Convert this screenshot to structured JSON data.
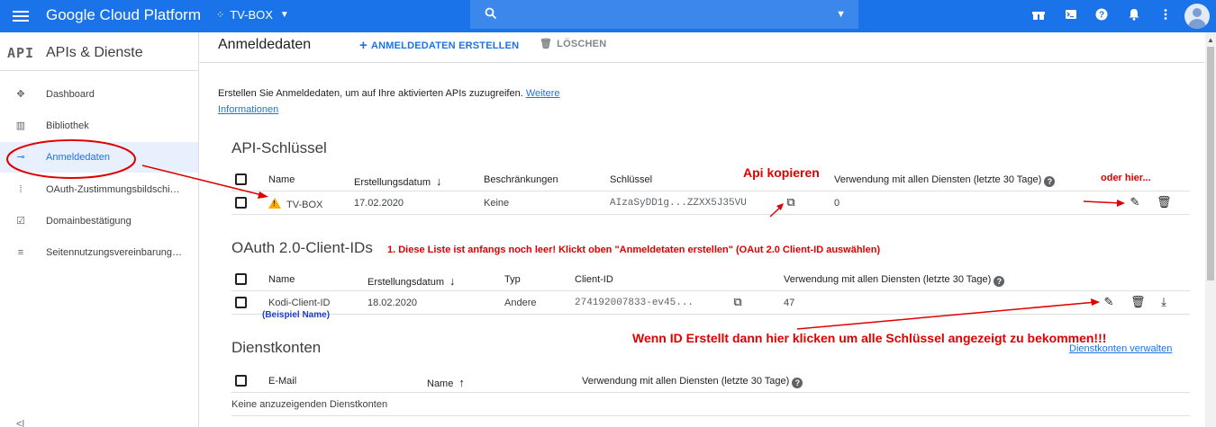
{
  "topbar": {
    "brand": "Google Cloud Platform",
    "project": "TV-BOX",
    "icons": [
      "menu-icon",
      "search-icon",
      "gift-icon",
      "terminal-icon",
      "help-icon",
      "bell-icon",
      "more-icon",
      "avatar"
    ]
  },
  "sidebar": {
    "logo": "API",
    "title": "APIs & Dienste",
    "items": [
      {
        "label": "Dashboard",
        "icon": "dashboard-icon"
      },
      {
        "label": "Bibliothek",
        "icon": "library-icon"
      },
      {
        "label": "Anmeldedaten",
        "icon": "key-icon",
        "active": true
      },
      {
        "label": "OAuth-Zustimmungsbildschi…",
        "icon": "consent-icon"
      },
      {
        "label": "Domainbestätigung",
        "icon": "checkbox-icon"
      },
      {
        "label": "Seitennutzungsvereinbarung…",
        "icon": "settings-list-icon"
      }
    ],
    "collapse": "<|"
  },
  "header": {
    "title": "Anmeldedaten",
    "create_label": "ANMELDEDATEN ERSTELLEN",
    "delete_label": "LÖSCHEN"
  },
  "intro": {
    "text": "Erstellen Sie Anmeldedaten, um auf Ihre aktivierten APIs zuzugreifen. ",
    "link1": "Weitere",
    "link2": "Informationen"
  },
  "api_keys": {
    "title": "API-Schlüssel",
    "columns": [
      "Name",
      "Erstellungsdatum",
      "Beschränkungen",
      "Schlüssel",
      "Verwendung mit allen Diensten (letzte 30 Tage)"
    ],
    "rows": [
      {
        "name": "TV-BOX",
        "date": "17.02.2020",
        "restrictions": "Keine",
        "key": "AIzaSyDD1g...ZZXX5J35VU",
        "usage": "0"
      }
    ]
  },
  "oauth": {
    "title": "OAuth 2.0-Client-IDs",
    "columns": [
      "Name",
      "Erstellungsdatum",
      "Typ",
      "Client-ID",
      "Verwendung mit allen Diensten (letzte 30 Tage)"
    ],
    "rows": [
      {
        "name": "Kodi-Client-ID",
        "date": "18.02.2020",
        "type": "Andere",
        "client_id": "274192007833-ev45...",
        "usage": "47"
      }
    ]
  },
  "service_accounts": {
    "title": "Dienstkonten",
    "manage_link": "Dienstkonten verwalten",
    "columns": [
      "E-Mail",
      "Name",
      "Verwendung mit allen Diensten (letzte 30 Tage)"
    ],
    "empty": "Keine anzuzeigenden Dienstkonten"
  },
  "annotations": {
    "api_copy": "Api kopieren",
    "or_here": "oder hier...",
    "list_note": "1. Diese Liste ist anfangs noch leer! Klickt oben \"Anmeldetaten erstellen\" (OAut 2.0 Client-ID auswählen)",
    "example_name": "(Beispiel Name)",
    "click_note": "Wenn ID Erstellt dann hier klicken um alle Schlüssel angezeigt zu bekommen!!!",
    "color": "#e00000"
  },
  "colors": {
    "accent": "#1a73e8",
    "warning": "#f9ab00"
  }
}
